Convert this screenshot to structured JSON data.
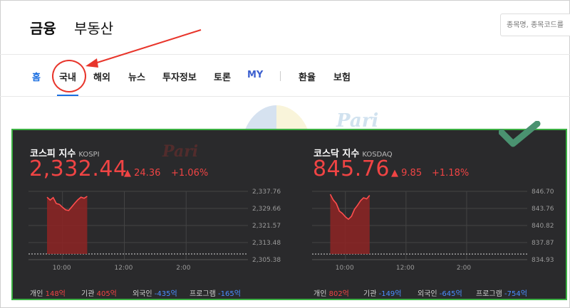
{
  "header": {
    "brand_primary": "금융",
    "brand_secondary": "부동산",
    "search_placeholder": "종목명, 종목코드를"
  },
  "nav": {
    "tabs": [
      {
        "label": "홈",
        "active": true
      },
      {
        "label": "국내",
        "active": false,
        "highlighted": true
      },
      {
        "label": "해외",
        "active": false
      },
      {
        "label": "뉴스",
        "active": false
      },
      {
        "label": "투자정보",
        "active": false
      },
      {
        "label": "토론",
        "active": false
      },
      {
        "label": "MY",
        "active": false
      },
      {
        "label": "환율",
        "active": false
      },
      {
        "label": "보험",
        "active": false
      }
    ]
  },
  "watermark": {
    "text": "Pari"
  },
  "colors": {
    "up": "#f04444",
    "down": "#4b8eff",
    "panel_bg": "#2a2a2c",
    "annotation_red": "#e8352b",
    "annotation_green": "#3cb043",
    "check_green": "#4a9270",
    "active_tab": "#1a6ee0"
  },
  "indices": {
    "kospi": {
      "name": "코스피 지수",
      "code": "KOSPI",
      "value": "2,332.44",
      "change_arrow": "▲",
      "change": "24.36",
      "change_pct": "+1.06%",
      "investors": [
        {
          "label": "개인",
          "value": "148억",
          "dir": "up"
        },
        {
          "label": "기관",
          "value": "405억",
          "dir": "up"
        },
        {
          "label": "외국인",
          "value": "-435억",
          "dir": "down"
        },
        {
          "label": "프로그램",
          "value": "-165억",
          "dir": "down"
        }
      ]
    },
    "kosdaq": {
      "name": "코스닥 지수",
      "code": "KOSDAQ",
      "value": "845.76",
      "change_arrow": "▲",
      "change": "9.85",
      "change_pct": "+1.18%",
      "investors": [
        {
          "label": "개인",
          "value": "802억",
          "dir": "up"
        },
        {
          "label": "기관",
          "value": "-149억",
          "dir": "down"
        },
        {
          "label": "외국인",
          "value": "-645억",
          "dir": "down"
        },
        {
          "label": "프로그램",
          "value": "-754억",
          "dir": "down"
        }
      ]
    }
  },
  "chart_data": [
    {
      "type": "line",
      "title": "",
      "series": [
        {
          "x": [
            0,
            0.1,
            0.2,
            0.3,
            0.4,
            0.5,
            0.6,
            0.7,
            0.8,
            0.9,
            1.0,
            1.1,
            1.2,
            1.3
          ],
          "values": [
            2335.0,
            2333.6,
            2334.8,
            2332.0,
            2331.6,
            2330.2,
            2329.0,
            2328.7,
            2330.4,
            2332.2,
            2333.8,
            2335.0,
            2334.5,
            2335.4
          ]
        }
      ],
      "x_ticks": [
        "10:00",
        "12:00",
        "2:00"
      ],
      "y_ticks": [
        "2,337.76",
        "2,329.66",
        "2,321.57",
        "2,313.48",
        "2,305.38"
      ],
      "y_tick_values": [
        2337.76,
        2329.66,
        2321.57,
        2313.48,
        2305.38
      ],
      "ylim": [
        2305.38,
        2337.76
      ],
      "xlim": [
        -0.6,
        6.5
      ],
      "x_tick_values": [
        0.5,
        2.5,
        4.5
      ],
      "baseline": 2308.08,
      "grid": true
    },
    {
      "type": "line",
      "title": "",
      "series": [
        {
          "x": [
            0,
            0.1,
            0.2,
            0.3,
            0.4,
            0.5,
            0.6,
            0.7,
            0.8,
            0.9,
            1.0,
            1.1,
            1.2,
            1.3
          ],
          "values": [
            846.2,
            845.2,
            844.6,
            843.3,
            842.9,
            842.3,
            841.9,
            842.4,
            843.6,
            844.3,
            845.1,
            845.6,
            845.4,
            846.0
          ]
        }
      ],
      "x_ticks": [
        "10:00",
        "12:00",
        "2:00"
      ],
      "y_ticks": [
        "846.70",
        "843.76",
        "840.82",
        "837.87",
        "834.93"
      ],
      "y_tick_values": [
        846.7,
        843.76,
        840.82,
        837.87,
        834.93
      ],
      "ylim": [
        834.93,
        846.7
      ],
      "xlim": [
        -0.6,
        6.5
      ],
      "x_tick_values": [
        0.5,
        2.5,
        4.5
      ],
      "baseline": 835.9,
      "grid": true
    }
  ]
}
